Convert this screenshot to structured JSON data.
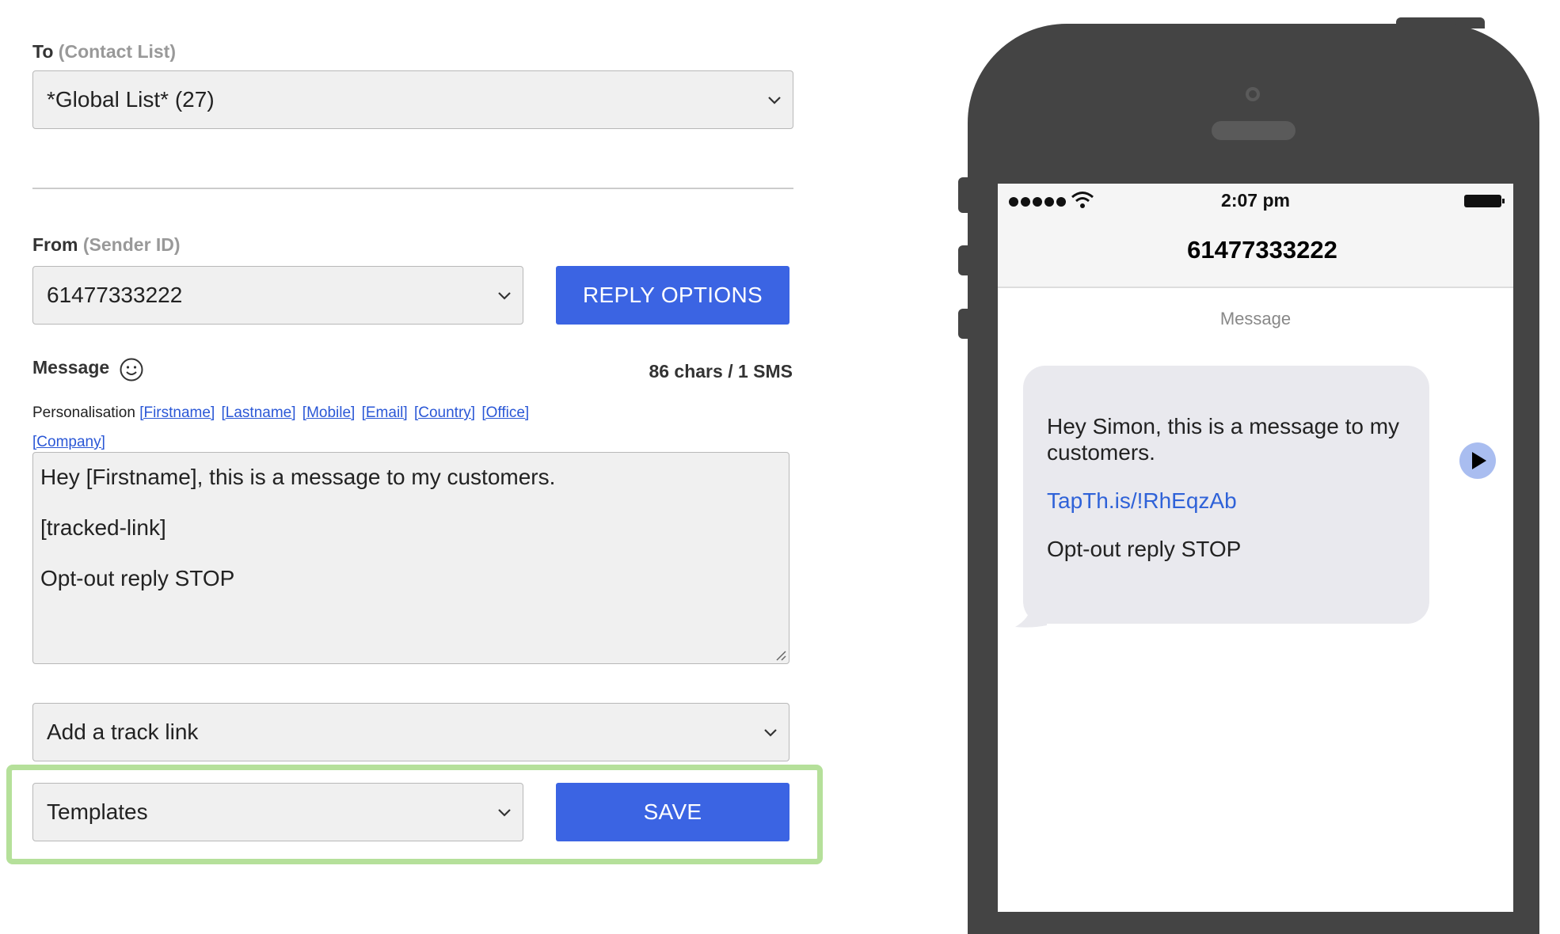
{
  "to": {
    "label": "To",
    "sublabel": "(Contact List)",
    "value": "*Global List* (27)"
  },
  "from": {
    "label": "From",
    "sublabel": "(Sender ID)",
    "value": "61477333222",
    "reply_button": "REPLY OPTIONS"
  },
  "message": {
    "label": "Message",
    "count": "86 chars / 1 SMS",
    "personalisation_label": "Personalisation",
    "tags": [
      "[Firstname]",
      "[Lastname]",
      "[Mobile]",
      "[Email]",
      "[Country]",
      "[Office]",
      "[Company]"
    ],
    "lines": [
      "Hey [Firstname], this is a message to my customers.",
      "[tracked-link]",
      "Opt-out reply STOP"
    ]
  },
  "track_link": {
    "value": "Add a track link"
  },
  "templates": {
    "value": "Templates",
    "save_button": "SAVE"
  },
  "colors": {
    "accent": "#3b64e3",
    "highlight": "#b5e09a"
  },
  "phone": {
    "time": "2:07 pm",
    "contact": "61477333222",
    "message_label": "Message",
    "bubble_lines": [
      "Hey Simon, this is a message to my customers.",
      "TapTh.is/!RhEqzAb",
      "Opt-out reply STOP"
    ]
  }
}
